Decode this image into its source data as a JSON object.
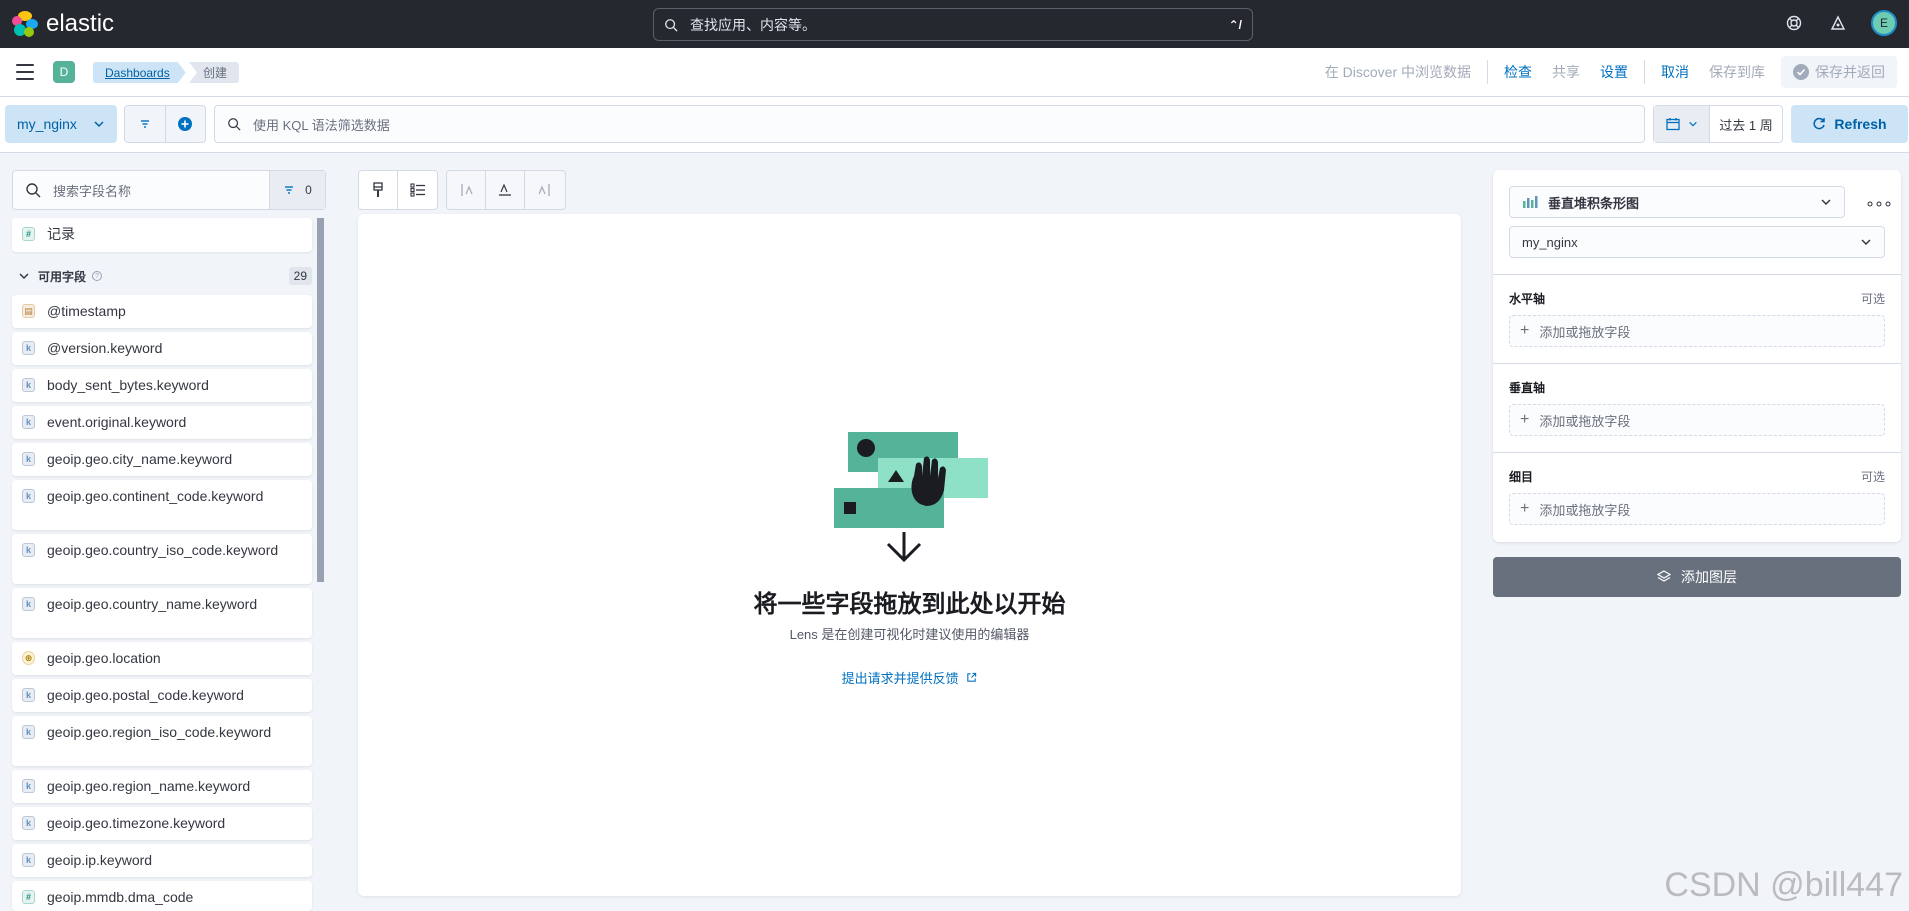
{
  "header": {
    "brand": "elastic",
    "search_placeholder": "查找应用、内容等。",
    "search_shortcut": "⌃/",
    "avatar_initial": "E"
  },
  "appbar": {
    "space_initial": "D",
    "breadcrumb_parent": "Dashboards",
    "breadcrumb_current": "创建",
    "discover_link": "在 Discover 中浏览数据",
    "inspect": "检查",
    "share": "共享",
    "settings": "设置",
    "cancel": "取消",
    "save_to_library": "保存到库",
    "save_and_return": "保存并返回"
  },
  "querybar": {
    "data_view": "my_nginx",
    "kql_placeholder": "使用 KQL 语法筛选数据",
    "time_range": "过去 1 周",
    "refresh": "Refresh"
  },
  "fields_panel": {
    "search_placeholder": "搜索字段名称",
    "filter_count": "0",
    "records_label": "记录",
    "available_label": "可用字段",
    "available_count": "29",
    "fields": [
      {
        "name": "@timestamp",
        "type": "date"
      },
      {
        "name": "@version.keyword",
        "type": "keyword"
      },
      {
        "name": "body_sent_bytes.keyword",
        "type": "keyword"
      },
      {
        "name": "event.original.keyword",
        "type": "keyword"
      },
      {
        "name": "geoip.geo.city_name.keyword",
        "type": "keyword"
      },
      {
        "name": "geoip.geo.continent_code.keyword",
        "type": "keyword"
      },
      {
        "name": "geoip.geo.country_iso_code.keyword",
        "type": "keyword"
      },
      {
        "name": "geoip.geo.country_name.keyword",
        "type": "keyword"
      },
      {
        "name": "geoip.geo.location",
        "type": "geo"
      },
      {
        "name": "geoip.geo.postal_code.keyword",
        "type": "keyword"
      },
      {
        "name": "geoip.geo.region_iso_code.keyword",
        "type": "keyword"
      },
      {
        "name": "geoip.geo.region_name.keyword",
        "type": "keyword"
      },
      {
        "name": "geoip.geo.timezone.keyword",
        "type": "keyword"
      },
      {
        "name": "geoip.ip.keyword",
        "type": "keyword"
      },
      {
        "name": "geoip.mmdb.dma_code",
        "type": "number"
      }
    ],
    "token_letters": {
      "keyword": "k",
      "number": "#",
      "date": "▤",
      "geo": "⊕"
    }
  },
  "workspace": {
    "title": "将一些字段拖放到此处以开始",
    "subtitle": "Lens 是在创建可视化时建议使用的编辑器",
    "feedback_link": "提出请求并提供反馈"
  },
  "config": {
    "vis_type": "垂直堆积条形图",
    "data_view": "my_nginx",
    "x_axis_label": "水平轴",
    "y_axis_label": "垂直轴",
    "breakdown_label": "细目",
    "optional": "可选",
    "dropzone_text": "添加或拖放字段",
    "add_layer": "添加图层"
  },
  "watermark": "CSDN @bill447",
  "colors": {
    "header_bg": "#25282f",
    "primary": "#0071c2",
    "accent_green": "#54b399"
  }
}
